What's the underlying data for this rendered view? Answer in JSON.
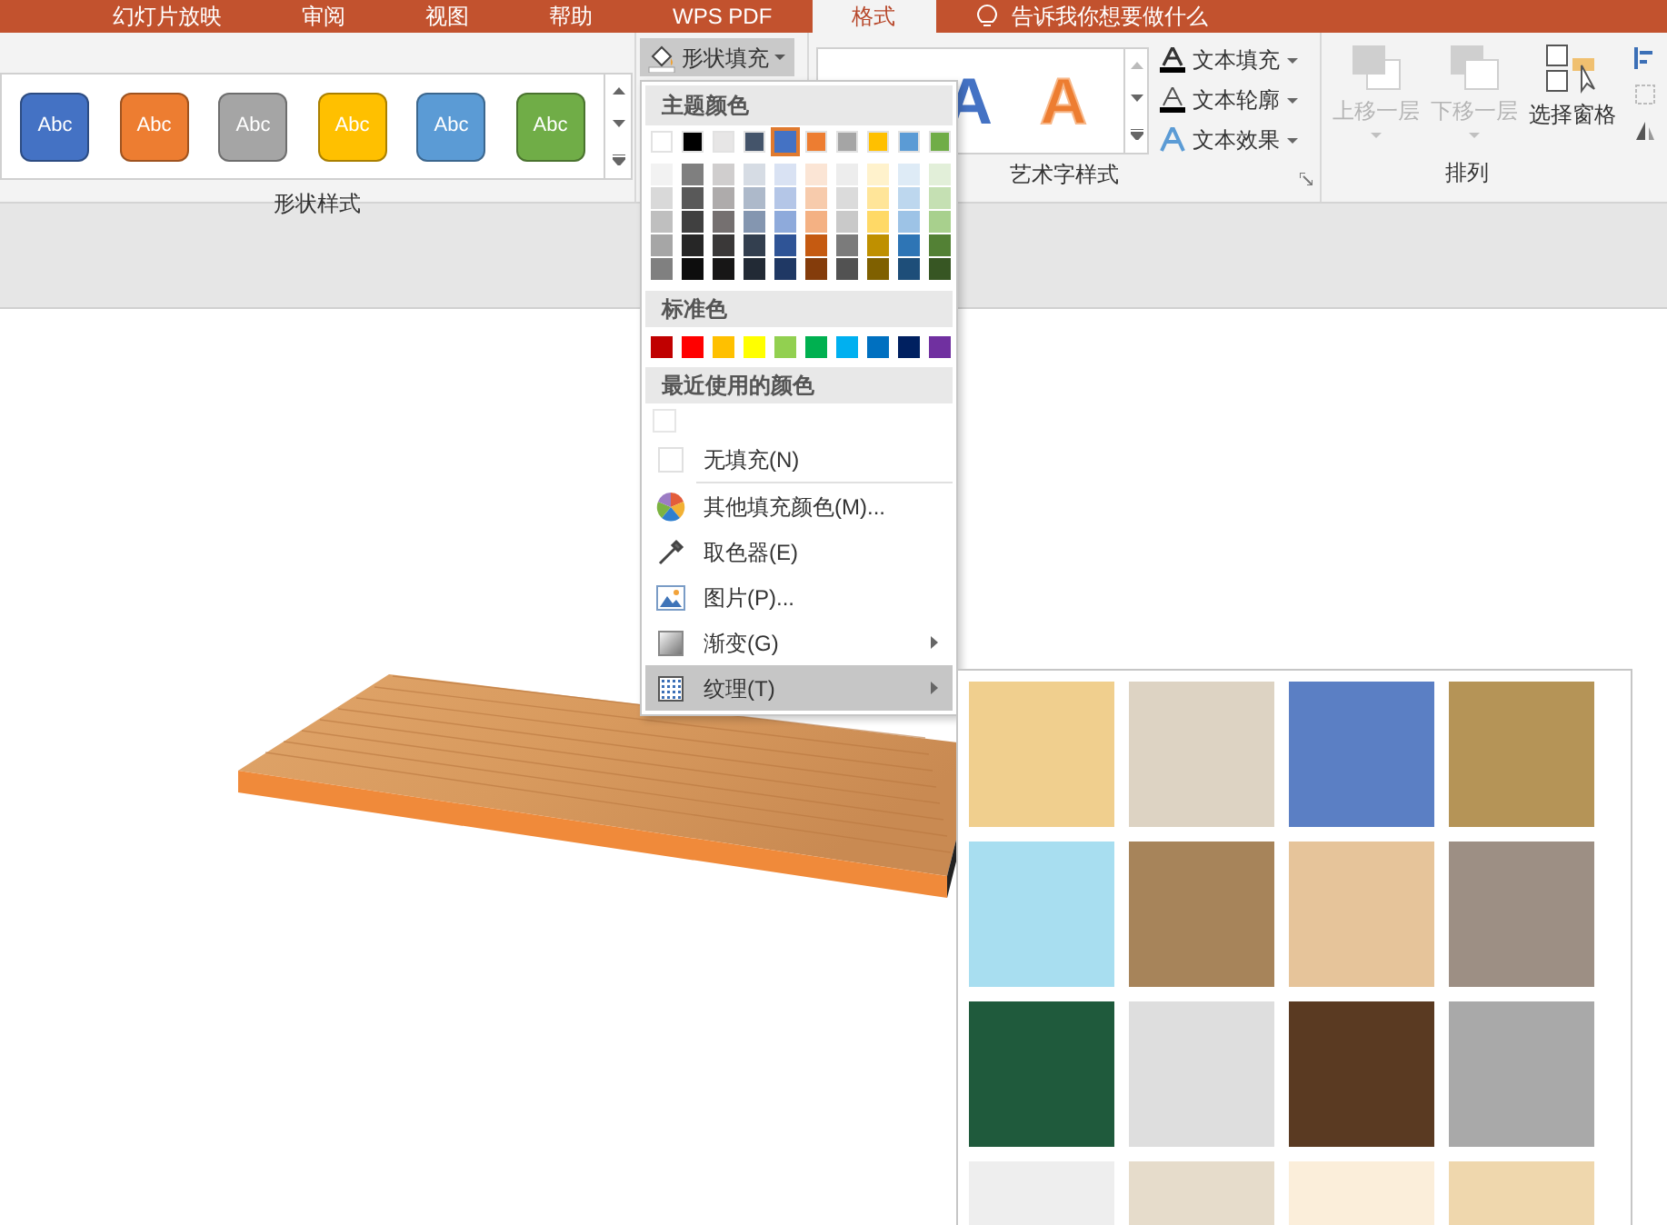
{
  "tabs": [
    {
      "label": "幻灯片放映",
      "selected": false
    },
    {
      "label": "审阅",
      "selected": false
    },
    {
      "label": "视图",
      "selected": false
    },
    {
      "label": "帮助",
      "selected": false
    },
    {
      "label": "WPS PDF",
      "selected": false
    },
    {
      "label": "格式",
      "selected": true
    }
  ],
  "tell_me": "告诉我你想要做什么",
  "shape_styles": {
    "items": [
      {
        "label": "Abc",
        "color": "#4472c4"
      },
      {
        "label": "Abc",
        "color": "#ed7d31"
      },
      {
        "label": "Abc",
        "color": "#a5a5a5"
      },
      {
        "label": "Abc",
        "color": "#ffc000"
      },
      {
        "label": "Abc",
        "color": "#5b9bd5"
      },
      {
        "label": "Abc",
        "color": "#70ad47"
      }
    ],
    "group_label": "形状样式"
  },
  "shape_fill_button": "形状填充",
  "wordart": {
    "samples": [
      {
        "label": "A",
        "color": "#4472c4",
        "outline": false
      },
      {
        "label": "A",
        "color": "#ed7d31",
        "outline": true
      }
    ],
    "buttons": [
      {
        "label": "文本填充",
        "kind": "fill"
      },
      {
        "label": "文本轮廓",
        "kind": "outline"
      },
      {
        "label": "文本效果",
        "kind": "effects"
      }
    ],
    "group_label": "艺术字样式"
  },
  "arrange": {
    "buttons": [
      {
        "label": "上移一层",
        "kind": "forward",
        "disabled": true
      },
      {
        "label": "下移一层",
        "kind": "backward",
        "disabled": true
      },
      {
        "label": "选择窗格",
        "kind": "pane",
        "disabled": false
      }
    ],
    "group_label": "排列"
  },
  "fill_menu": {
    "theme_header": "主题颜色",
    "theme_colors": [
      {
        "color": "#ffffff",
        "selected": false,
        "shades": [
          {
            "color": "#f2f2f2"
          },
          {
            "color": "#d9d9d9"
          },
          {
            "color": "#bfbfbf"
          },
          {
            "color": "#a6a6a6"
          },
          {
            "color": "#808080"
          }
        ]
      },
      {
        "color": "#000000",
        "selected": false,
        "shades": [
          {
            "color": "#7f7f7f"
          },
          {
            "color": "#595959"
          },
          {
            "color": "#404040"
          },
          {
            "color": "#262626"
          },
          {
            "color": "#0d0d0d"
          }
        ]
      },
      {
        "color": "#e7e6e6",
        "selected": false,
        "shades": [
          {
            "color": "#d0cece"
          },
          {
            "color": "#aeabab"
          },
          {
            "color": "#757070"
          },
          {
            "color": "#3a3838"
          },
          {
            "color": "#171616"
          }
        ]
      },
      {
        "color": "#44546a",
        "selected": false,
        "shades": [
          {
            "color": "#d6dce4"
          },
          {
            "color": "#adb9ca"
          },
          {
            "color": "#8496b0"
          },
          {
            "color": "#333f4f"
          },
          {
            "color": "#222a35"
          }
        ]
      },
      {
        "color": "#4472c4",
        "selected": true,
        "shades": [
          {
            "color": "#d9e2f3"
          },
          {
            "color": "#b4c6e7"
          },
          {
            "color": "#8eaadb"
          },
          {
            "color": "#2f5496"
          },
          {
            "color": "#1f3864"
          }
        ]
      },
      {
        "color": "#ed7d31",
        "selected": false,
        "shades": [
          {
            "color": "#fbe5d5"
          },
          {
            "color": "#f7cbac"
          },
          {
            "color": "#f4b183"
          },
          {
            "color": "#c55a11"
          },
          {
            "color": "#843c0b"
          }
        ]
      },
      {
        "color": "#a5a5a5",
        "selected": false,
        "shades": [
          {
            "color": "#ededed"
          },
          {
            "color": "#dbdbdb"
          },
          {
            "color": "#c9c9c9"
          },
          {
            "color": "#7b7b7b"
          },
          {
            "color": "#525252"
          }
        ]
      },
      {
        "color": "#ffc000",
        "selected": false,
        "shades": [
          {
            "color": "#fff2cc"
          },
          {
            "color": "#ffe599"
          },
          {
            "color": "#ffd966"
          },
          {
            "color": "#bf9000"
          },
          {
            "color": "#7f6000"
          }
        ]
      },
      {
        "color": "#5b9bd5",
        "selected": false,
        "shades": [
          {
            "color": "#deebf6"
          },
          {
            "color": "#bdd7ee"
          },
          {
            "color": "#9dc3e6"
          },
          {
            "color": "#2e75b5"
          },
          {
            "color": "#1e4e79"
          }
        ]
      },
      {
        "color": "#70ad47",
        "selected": false,
        "shades": [
          {
            "color": "#e2efd9"
          },
          {
            "color": "#c5e0b3"
          },
          {
            "color": "#a8d08d"
          },
          {
            "color": "#538135"
          },
          {
            "color": "#375623"
          }
        ]
      }
    ],
    "standard_header": "标准色",
    "standard_colors": [
      {
        "color": "#c00000"
      },
      {
        "color": "#ff0000"
      },
      {
        "color": "#ffc000"
      },
      {
        "color": "#ffff00"
      },
      {
        "color": "#92d050"
      },
      {
        "color": "#00b050"
      },
      {
        "color": "#00b0f0"
      },
      {
        "color": "#0070c0"
      },
      {
        "color": "#002060"
      },
      {
        "color": "#7030a0"
      }
    ],
    "recent_header": "最近使用的颜色",
    "items": [
      {
        "label": "无填充(N)",
        "kind": "no_fill",
        "submenu": false,
        "selected": false
      },
      {
        "label": "其他填充颜色(M)...",
        "kind": "more_colors",
        "submenu": false,
        "selected": false
      },
      {
        "label": "取色器(E)",
        "kind": "eyedropper",
        "submenu": false,
        "selected": false
      },
      {
        "label": "图片(P)...",
        "kind": "picture",
        "submenu": false,
        "selected": false
      },
      {
        "label": "渐变(G)",
        "kind": "gradient",
        "submenu": true,
        "selected": false
      },
      {
        "label": "纹理(T)",
        "kind": "texture",
        "submenu": true,
        "selected": true
      }
    ]
  }
}
